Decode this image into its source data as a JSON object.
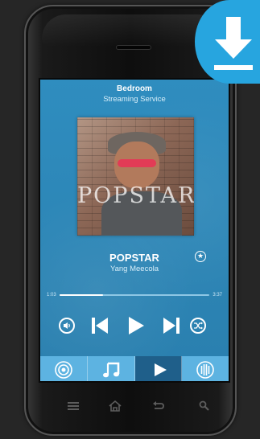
{
  "header": {
    "room": "Bedroom",
    "service": "Streaming Service"
  },
  "album": {
    "cover_text": "POPSTAR"
  },
  "now_playing": {
    "title": "POPSTAR",
    "artist": "Yang Meecola",
    "favorite_icon": "star-circle-icon"
  },
  "progress": {
    "elapsed": "1:03",
    "duration": "3:37",
    "fraction": 0.29
  },
  "controls": [
    {
      "name": "volume-button",
      "icon": "volume-icon"
    },
    {
      "name": "previous-button",
      "icon": "skip-back-icon"
    },
    {
      "name": "play-button",
      "icon": "play-icon"
    },
    {
      "name": "next-button",
      "icon": "skip-forward-icon"
    },
    {
      "name": "shuffle-button",
      "icon": "shuffle-icon"
    }
  ],
  "tabs": [
    {
      "name": "tab-zones",
      "icon": "target-icon",
      "active": false
    },
    {
      "name": "tab-music",
      "icon": "music-note-icon",
      "active": false
    },
    {
      "name": "tab-now-playing",
      "icon": "play-icon",
      "active": true
    },
    {
      "name": "tab-queue",
      "icon": "bars-circle-icon",
      "active": false
    }
  ],
  "nav_bar": [
    "menu-icon",
    "home-icon",
    "back-icon",
    "search-icon"
  ],
  "download_badge": {
    "icon": "download-arrow-icon"
  },
  "colors": {
    "screen": "#2e87b7",
    "tabbar": "#5db3e1",
    "tab_active": "#1f5f8a",
    "badge": "#27a5df"
  }
}
